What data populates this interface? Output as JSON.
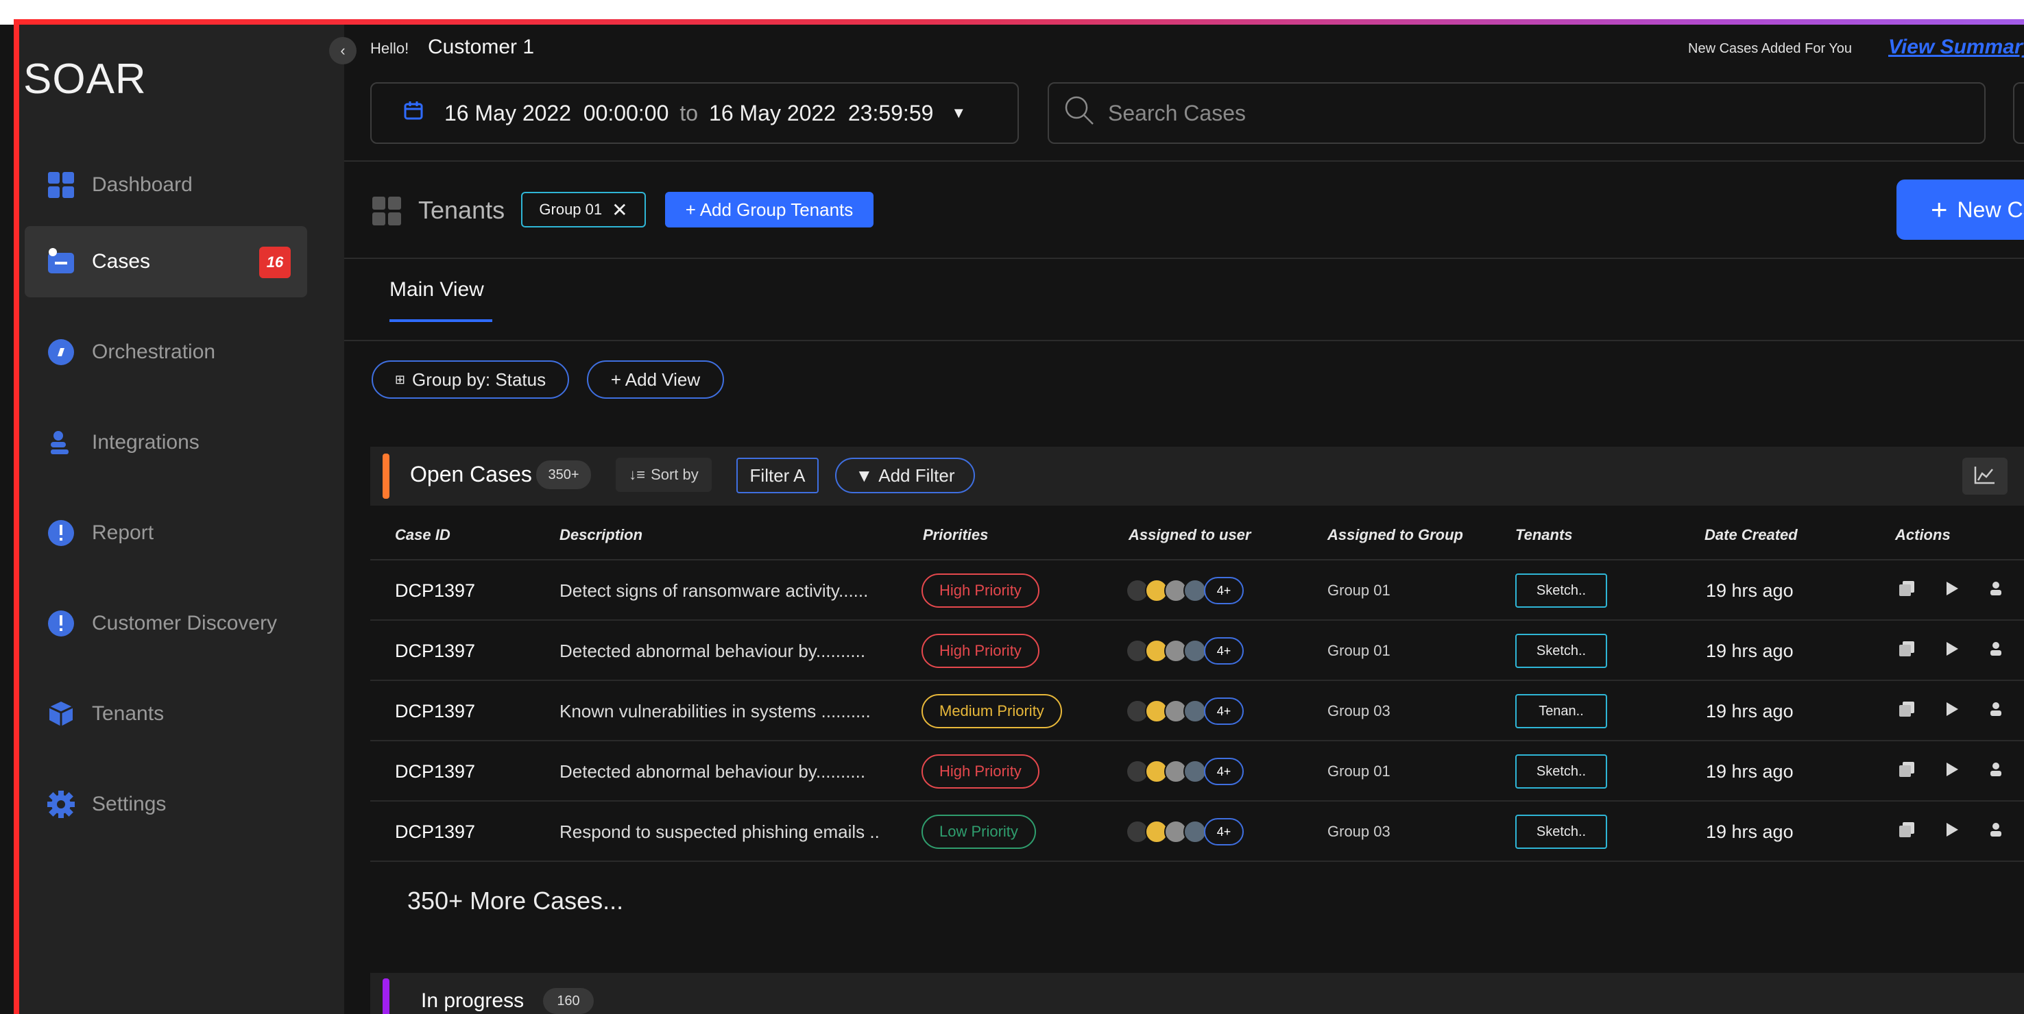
{
  "app": {
    "brand": "SOAR"
  },
  "sidebar": {
    "items": [
      {
        "label": "Dashboard",
        "icon": "dashboard-icon",
        "color": "#3f6fe0"
      },
      {
        "label": "Cases",
        "icon": "cases-icon",
        "color": "#3f6fe0",
        "badge": "16",
        "active": true
      },
      {
        "label": "Orchestration",
        "icon": "orchestration-icon",
        "color": "#3f6fe0"
      },
      {
        "label": "Integrations",
        "icon": "integrations-icon",
        "color": "#3f6fe0"
      },
      {
        "label": "Report",
        "icon": "report-icon",
        "color": "#3f6fe0"
      },
      {
        "label": "Customer Discovery",
        "icon": "customer-discovery-icon",
        "color": "#3f6fe0"
      },
      {
        "label": "Tenants",
        "icon": "tenants-icon",
        "color": "#3f6fe0"
      },
      {
        "label": "Settings",
        "icon": "settings-icon",
        "color": "#3f6fe0"
      }
    ]
  },
  "header": {
    "hello": "Hello!",
    "customer": "Customer 1",
    "new_cases_text": "New Cases Added For You",
    "view_summary": "View Summary",
    "date_from": "16 May 2022  00:00:00",
    "date_to_word": "to",
    "date_to": "16 May 2022  23:59:59",
    "search_placeholder": "Search Cases"
  },
  "tenants_bar": {
    "label": "Tenants",
    "chip": "Group 01",
    "add_group": "+ Add Group Tenants",
    "new_case": "New Case"
  },
  "tabs": {
    "main": "Main View"
  },
  "view_controls": {
    "group_by": "Group by: Status",
    "add_view": "+ Add View"
  },
  "open_section": {
    "title": "Open Cases",
    "count": "350+",
    "sort_by": "Sort by",
    "filter_a": "Filter A",
    "add_filter": "Add Filter"
  },
  "table": {
    "columns": [
      "Case ID",
      "Description",
      "Priorities",
      "Assigned to user",
      "Assigned to Group",
      "Tenants",
      "Date Created",
      "Actions"
    ],
    "rows": [
      {
        "id": "DCP1397",
        "description": "Detect signs of ransomware activity......",
        "priority": "High Priority",
        "more_users": "4+",
        "group": "Group 01",
        "tenant": "Sketch..",
        "date": "19 hrs ago"
      },
      {
        "id": "DCP1397",
        "description": "Detected abnormal behaviour by..........",
        "priority": "High Priority",
        "more_users": "4+",
        "group": "Group 01",
        "tenant": "Sketch..",
        "date": "19 hrs ago"
      },
      {
        "id": "DCP1397",
        "description": "Known vulnerabilities in systems ..........",
        "priority": "Medium Priority",
        "more_users": "4+",
        "group": "Group 03",
        "tenant": "Tenan..",
        "date": "19 hrs ago"
      },
      {
        "id": "DCP1397",
        "description": "Detected abnormal behaviour by..........",
        "priority": "High Priority",
        "more_users": "4+",
        "group": "Group 01",
        "tenant": "Sketch..",
        "date": "19 hrs ago"
      },
      {
        "id": "DCP1397",
        "description": "Respond to suspected phishing emails ..",
        "priority": "Low Priority",
        "more_users": "4+",
        "group": "Group 03",
        "tenant": "Sketch..",
        "date": "19 hrs ago"
      }
    ],
    "priority_colors": {
      "High Priority": "#e5484d",
      "Medium Priority": "#e8b83a",
      "Low Priority": "#2f9e6e"
    }
  },
  "more_cases": "350+ More Cases...",
  "in_progress": {
    "title": "In progress",
    "count": "160"
  },
  "colors": {
    "accent": "#2f6bff",
    "open_accent": "#ff7a2f",
    "progress_accent": "#a020f0",
    "badge_red": "#e5322f"
  }
}
